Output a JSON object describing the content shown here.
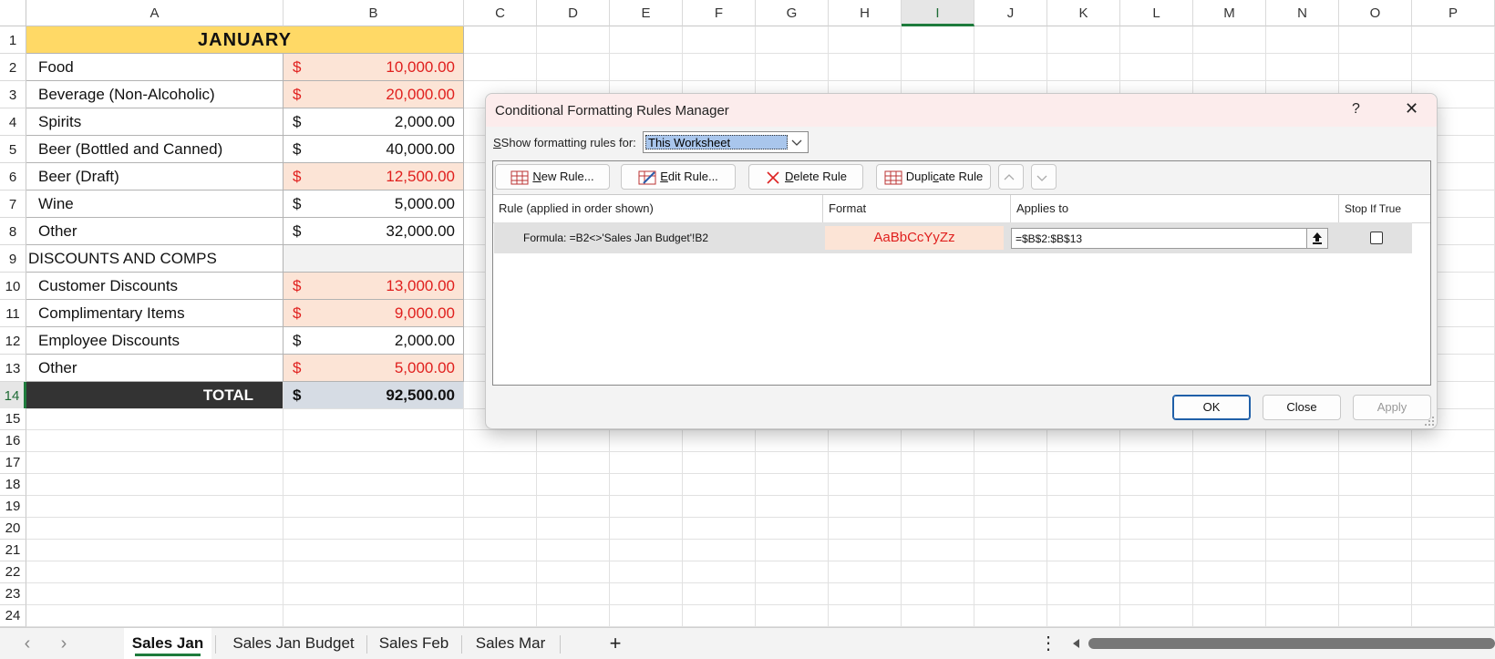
{
  "columns": [
    "A",
    "B",
    "C",
    "D",
    "E",
    "F",
    "G",
    "H",
    "I",
    "J",
    "K",
    "L",
    "M",
    "N",
    "O",
    "P"
  ],
  "rows": [
    "1",
    "2",
    "3",
    "4",
    "5",
    "6",
    "7",
    "8",
    "9",
    "10",
    "11",
    "12",
    "13",
    "14",
    "15",
    "16",
    "17",
    "18",
    "19",
    "20",
    "21",
    "22",
    "23",
    "24"
  ],
  "sheet": {
    "title": "JANUARY",
    "items": [
      {
        "label": "Food",
        "currency": "$",
        "amount": "10,000.00",
        "highlight": true
      },
      {
        "label": "Beverage (Non-Alcoholic)",
        "currency": "$",
        "amount": "20,000.00",
        "highlight": true
      },
      {
        "label": "Spirits",
        "currency": "$",
        "amount": "2,000.00",
        "highlight": false
      },
      {
        "label": "Beer (Bottled and Canned)",
        "currency": "$",
        "amount": "40,000.00",
        "highlight": false
      },
      {
        "label": "Beer (Draft)",
        "currency": "$",
        "amount": "12,500.00",
        "highlight": true
      },
      {
        "label": "Wine",
        "currency": "$",
        "amount": "5,000.00",
        "highlight": false
      },
      {
        "label": "Other",
        "currency": "$",
        "amount": "32,000.00",
        "highlight": false
      }
    ],
    "section_label": "DISCOUNTS AND COMPS",
    "discounts": [
      {
        "label": "Customer Discounts",
        "currency": "$",
        "amount": "13,000.00",
        "highlight": true
      },
      {
        "label": "Complimentary Items",
        "currency": "$",
        "amount": "9,000.00",
        "highlight": true
      },
      {
        "label": "Employee Discounts",
        "currency": "$",
        "amount": "2,000.00",
        "highlight": false
      },
      {
        "label": "Other",
        "currency": "$",
        "amount": "5,000.00",
        "highlight": true
      }
    ],
    "total_label": "TOTAL",
    "total_currency": "$",
    "total_amount": "92,500.00"
  },
  "tabs": {
    "items": [
      "Sales Jan",
      "Sales Jan Budget",
      "Sales Feb",
      "Sales Mar"
    ],
    "add": "+",
    "prev": "‹",
    "next": "›",
    "more": "⋮"
  },
  "dialog": {
    "title": "Conditional Formatting Rules Manager",
    "help": "?",
    "close_icon": "✕",
    "show_label": "Show formatting rules for:",
    "scope_value": "This Worksheet",
    "new_rule": "New Rule...",
    "edit_rule": "Edit Rule...",
    "delete_rule": "Delete Rule",
    "duplicate_rule": "Duplicate Rule",
    "col_rule": "Rule (applied in order shown)",
    "col_format": "Format",
    "col_applies": "Applies to",
    "col_stop": "Stop If True",
    "rule_formula": "Formula: =B2<>'Sales Jan Budget'!B2",
    "rule_preview": "AaBbCcYyZz",
    "rule_applies": "=$B$2:$B$13",
    "ok": "OK",
    "close": "Close",
    "apply": "Apply"
  },
  "colors": {
    "header_fill": "#ffd966",
    "highlight_fill": "#fce4d6",
    "highlight_text": "#e0201e",
    "total_fill": "#333333",
    "accent": "#1e7b3c"
  }
}
